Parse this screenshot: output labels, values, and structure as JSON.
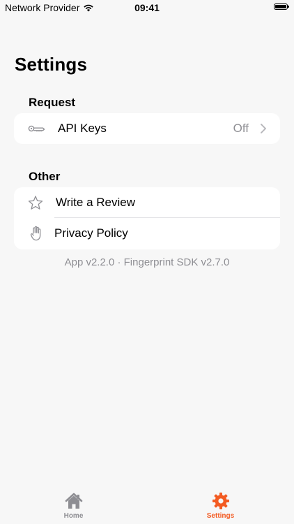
{
  "status_bar": {
    "carrier": "Network Provider",
    "time": "09:41"
  },
  "page": {
    "title": "Settings"
  },
  "sections": {
    "request": {
      "header": "Request",
      "api_keys": {
        "label": "API Keys",
        "value": "Off",
        "icon": "key-icon"
      }
    },
    "other": {
      "header": "Other",
      "review": {
        "label": "Write a Review",
        "icon": "star-icon"
      },
      "privacy": {
        "label": "Privacy Policy",
        "icon": "hand-icon"
      }
    }
  },
  "footer": {
    "version": "App v2.2.0 · Fingerprint SDK v2.7.0"
  },
  "tab_bar": {
    "home": {
      "label": "Home",
      "icon": "home-icon"
    },
    "settings": {
      "label": "Settings",
      "icon": "gear-icon"
    }
  },
  "colors": {
    "accent": "#f35b22",
    "inactive": "#8e8e93",
    "background": "#f7f7f7",
    "card": "#ffffff"
  }
}
